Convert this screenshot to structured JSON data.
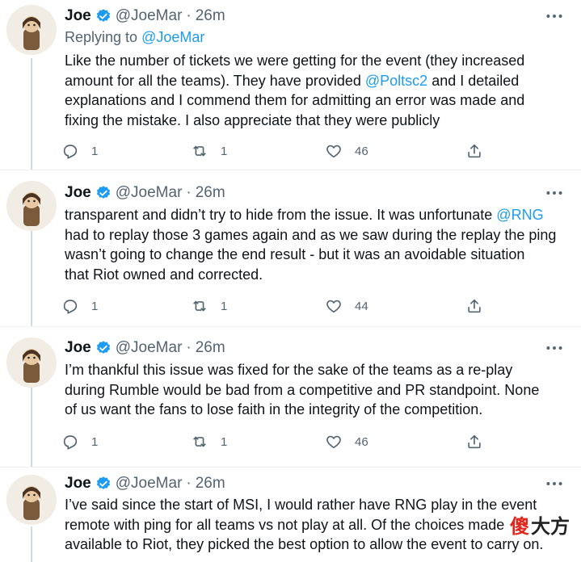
{
  "tweets": [
    {
      "author": "Joe",
      "handle": "@JoeMar",
      "separator": "·",
      "time": "26m",
      "replying_prefix": "Replying to ",
      "replying_to": "@JoeMar",
      "lines": [
        [
          "Like the number of tickets we were getting for the event (they increased"
        ],
        [
          "amount for all the teams). They have provided ",
          "@Poltsc2",
          " and I detailed"
        ],
        [
          "explanations and I commend them for admitting an error was made and"
        ],
        [
          "fixing the mistake. I also appreciate that they were publicly"
        ]
      ],
      "replies": "1",
      "retweets": "1",
      "likes": "46"
    },
    {
      "author": "Joe",
      "handle": "@JoeMar",
      "separator": "·",
      "time": "26m",
      "lines": [
        [
          "transparent and didn’t try to hide from the issue. It was unfortunate ",
          "@RNG"
        ],
        [
          "had to replay those 3 games  again and as we saw during the replay the ping"
        ],
        [
          "wasn’t going to change the end result - but it was an avoidable situation"
        ],
        [
          "that Riot owned and corrected."
        ]
      ],
      "replies": "1",
      "retweets": "1",
      "likes": "44"
    },
    {
      "author": "Joe",
      "handle": "@JoeMar",
      "separator": "·",
      "time": "26m",
      "lines": [
        [
          "I’m thankful this issue was fixed for the sake of the teams as a re-play"
        ],
        [
          "during Rumble would be bad from a competitive and PR standpoint. None"
        ],
        [
          "of us want the fans to lose faith in the integrity of the competition."
        ]
      ],
      "replies": "1",
      "retweets": "1",
      "likes": "46"
    },
    {
      "author": "Joe",
      "handle": "@JoeMar",
      "separator": "·",
      "time": "26m",
      "lines": [
        [
          "I’ve said since the start of MSI, I would rather have RNG play in the event"
        ],
        [
          "remote with ping for all teams vs not play at all. Of the choices made"
        ],
        [
          "available to Riot, they picked the best option to allow the event to carry on."
        ]
      ]
    }
  ],
  "watermark": {
    "part1": "傻",
    "part2": "大方"
  },
  "colors": {
    "accent": "#1d9bf0",
    "muted": "#536471",
    "text": "#0f1419"
  },
  "icons": [
    "verified-badge-icon",
    "more-icon",
    "reply-icon",
    "retweet-icon",
    "like-icon",
    "share-icon"
  ]
}
